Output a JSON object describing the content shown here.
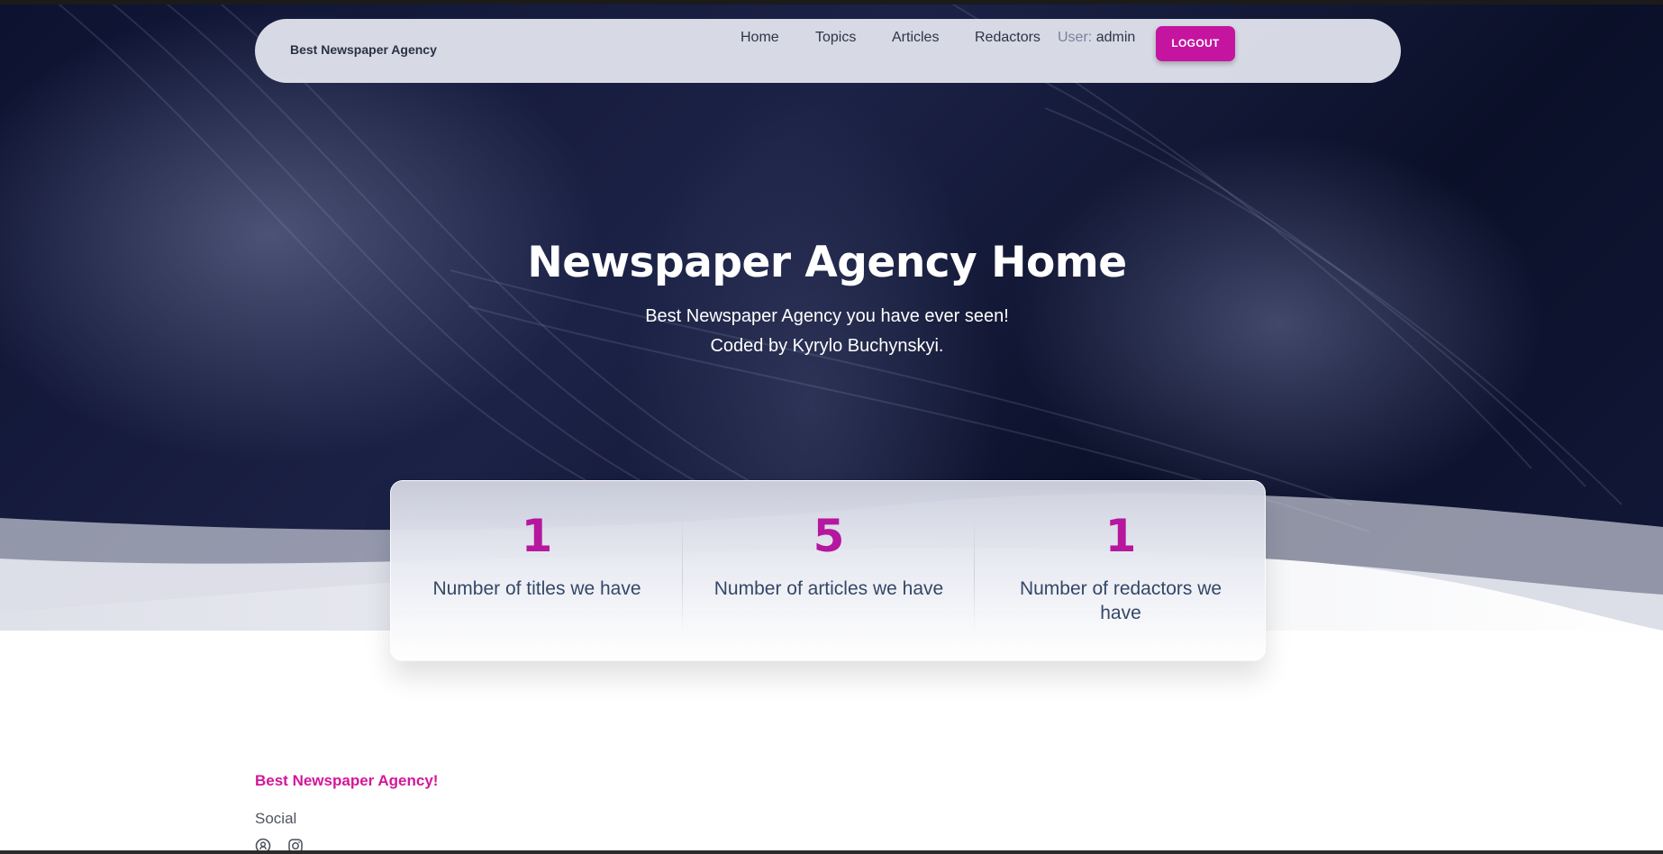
{
  "navbar": {
    "brand": "Best Newspaper Agency",
    "links": [
      "Home",
      "Topics",
      "Articles",
      "Redactors"
    ],
    "user_label": "User:",
    "user_name": "admin",
    "logout_label": "LOGOUT"
  },
  "hero": {
    "title": "Newspaper Agency Home",
    "subtitle_line1": "Best Newspaper Agency you have ever seen!",
    "subtitle_line2": "Coded by Kyrylo Buchynskyi."
  },
  "stats": [
    {
      "value": "1",
      "label": "Number of titles we have"
    },
    {
      "value": "5",
      "label": "Number of articles we have"
    },
    {
      "value": "1",
      "label": "Number of redactors we have"
    }
  ],
  "footer": {
    "brand": "Best Newspaper Agency!",
    "social_heading": "Social",
    "social_icons": [
      "github-icon",
      "instagram-icon"
    ]
  },
  "colors": {
    "accent": "#c414a0",
    "stat_number": "#b5179e",
    "footer_brand": "#d4169a",
    "hero_bg": "#0d1230"
  }
}
